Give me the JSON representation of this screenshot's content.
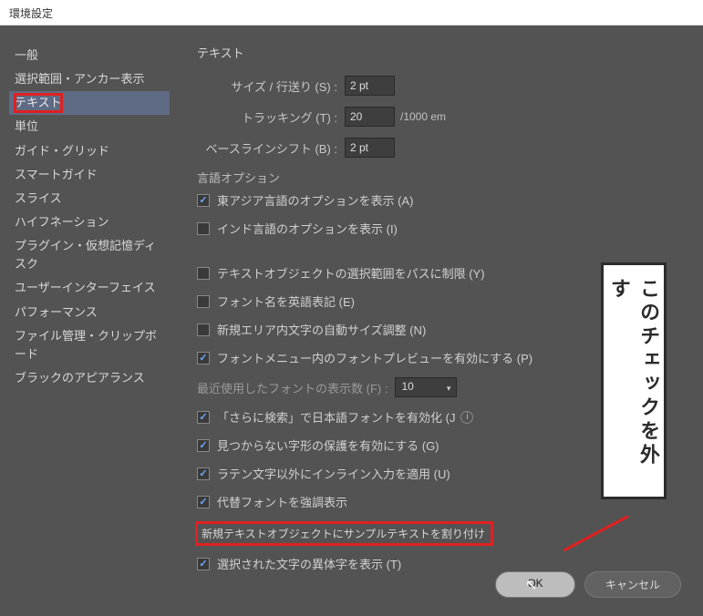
{
  "window": {
    "title": "環境設定"
  },
  "sidebar": {
    "items": [
      {
        "label": "一般"
      },
      {
        "label": "選択範囲・アンカー表示"
      },
      {
        "label": "テキスト",
        "selected": true,
        "highlighted": true
      },
      {
        "label": "単位"
      },
      {
        "label": "ガイド・グリッド"
      },
      {
        "label": "スマートガイド"
      },
      {
        "label": "スライス"
      },
      {
        "label": "ハイフネーション"
      },
      {
        "label": "プラグイン・仮想記憶ディスク"
      },
      {
        "label": "ユーザーインターフェイス"
      },
      {
        "label": "パフォーマンス"
      },
      {
        "label": "ファイル管理・クリップボード"
      },
      {
        "label": "ブラックのアピアランス"
      }
    ]
  },
  "main": {
    "heading": "テキスト",
    "size_leading_label": "サイズ / 行送り (S) :",
    "size_leading_value": "2 pt",
    "tracking_label": "トラッキング (T) :",
    "tracking_value": "20",
    "tracking_unit": "/1000 em",
    "baseline_label": "ベースラインシフト (B) :",
    "baseline_value": "2 pt",
    "lang_heading": "言語オプション",
    "east_asian_label": "東アジア言語のオプションを表示 (A)",
    "indic_label": "インド言語のオプションを表示 (I)",
    "limit_selection_label": "テキストオブジェクトの選択範囲をパスに制限 (Y)",
    "english_fontname_label": "フォント名を英語表記 (E)",
    "auto_size_label": "新規エリア内文字の自動サイズ調整 (N)",
    "font_preview_label": "フォントメニュー内のフォントプレビューを有効にする (P)",
    "recent_fonts_label": "最近使用したフォントの表示数 (F) :",
    "recent_fonts_value": "10",
    "more_search_label": "「さらに検索」で日本語フォントを有効化 (J",
    "glyph_protect_label": "見つからない字形の保護を有効にする (G)",
    "inline_input_label": "ラテン文字以外にインライン入力を適用 (U)",
    "substitute_font_label": "代替フォントを強調表示",
    "sample_text_label": "新規テキストオブジェクトにサンプルテキストを割り付け",
    "show_variants_label": "選択された文字の異体字を表示 (T)"
  },
  "callout": {
    "text": "このチェックを外す"
  },
  "buttons": {
    "ok": "OK",
    "cancel": "キャンセル"
  }
}
